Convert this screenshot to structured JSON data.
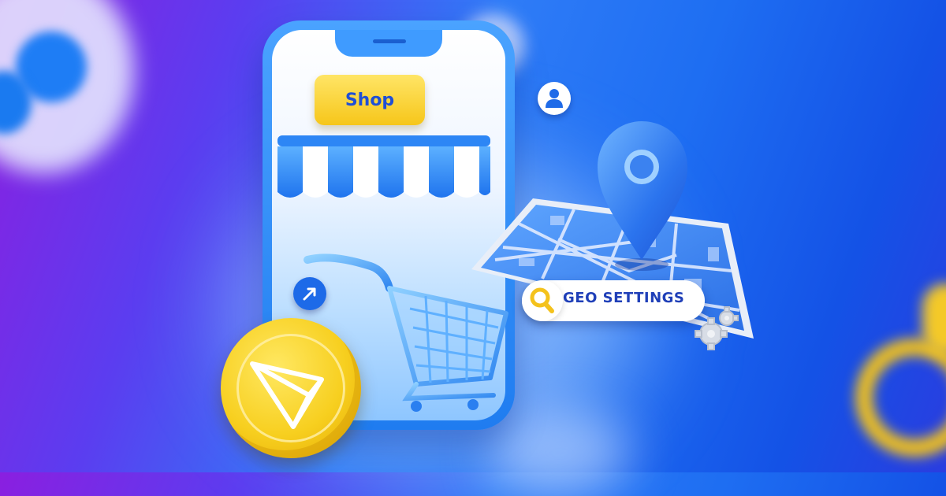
{
  "shop": {
    "label": "Shop"
  },
  "geo": {
    "label": "GEO SETTINGS"
  },
  "colors": {
    "brand_blue": "#1f7cf0",
    "accent_yellow": "#f7cf1f",
    "label_blue": "#1f3fb8"
  },
  "icons": {
    "coin": "tron-logo-icon",
    "pin": "location-pin-icon",
    "search": "search-icon",
    "gear": "gear-icon",
    "user": "user-icon",
    "cart": "shopping-cart-icon",
    "arrow": "arrow-icon"
  }
}
